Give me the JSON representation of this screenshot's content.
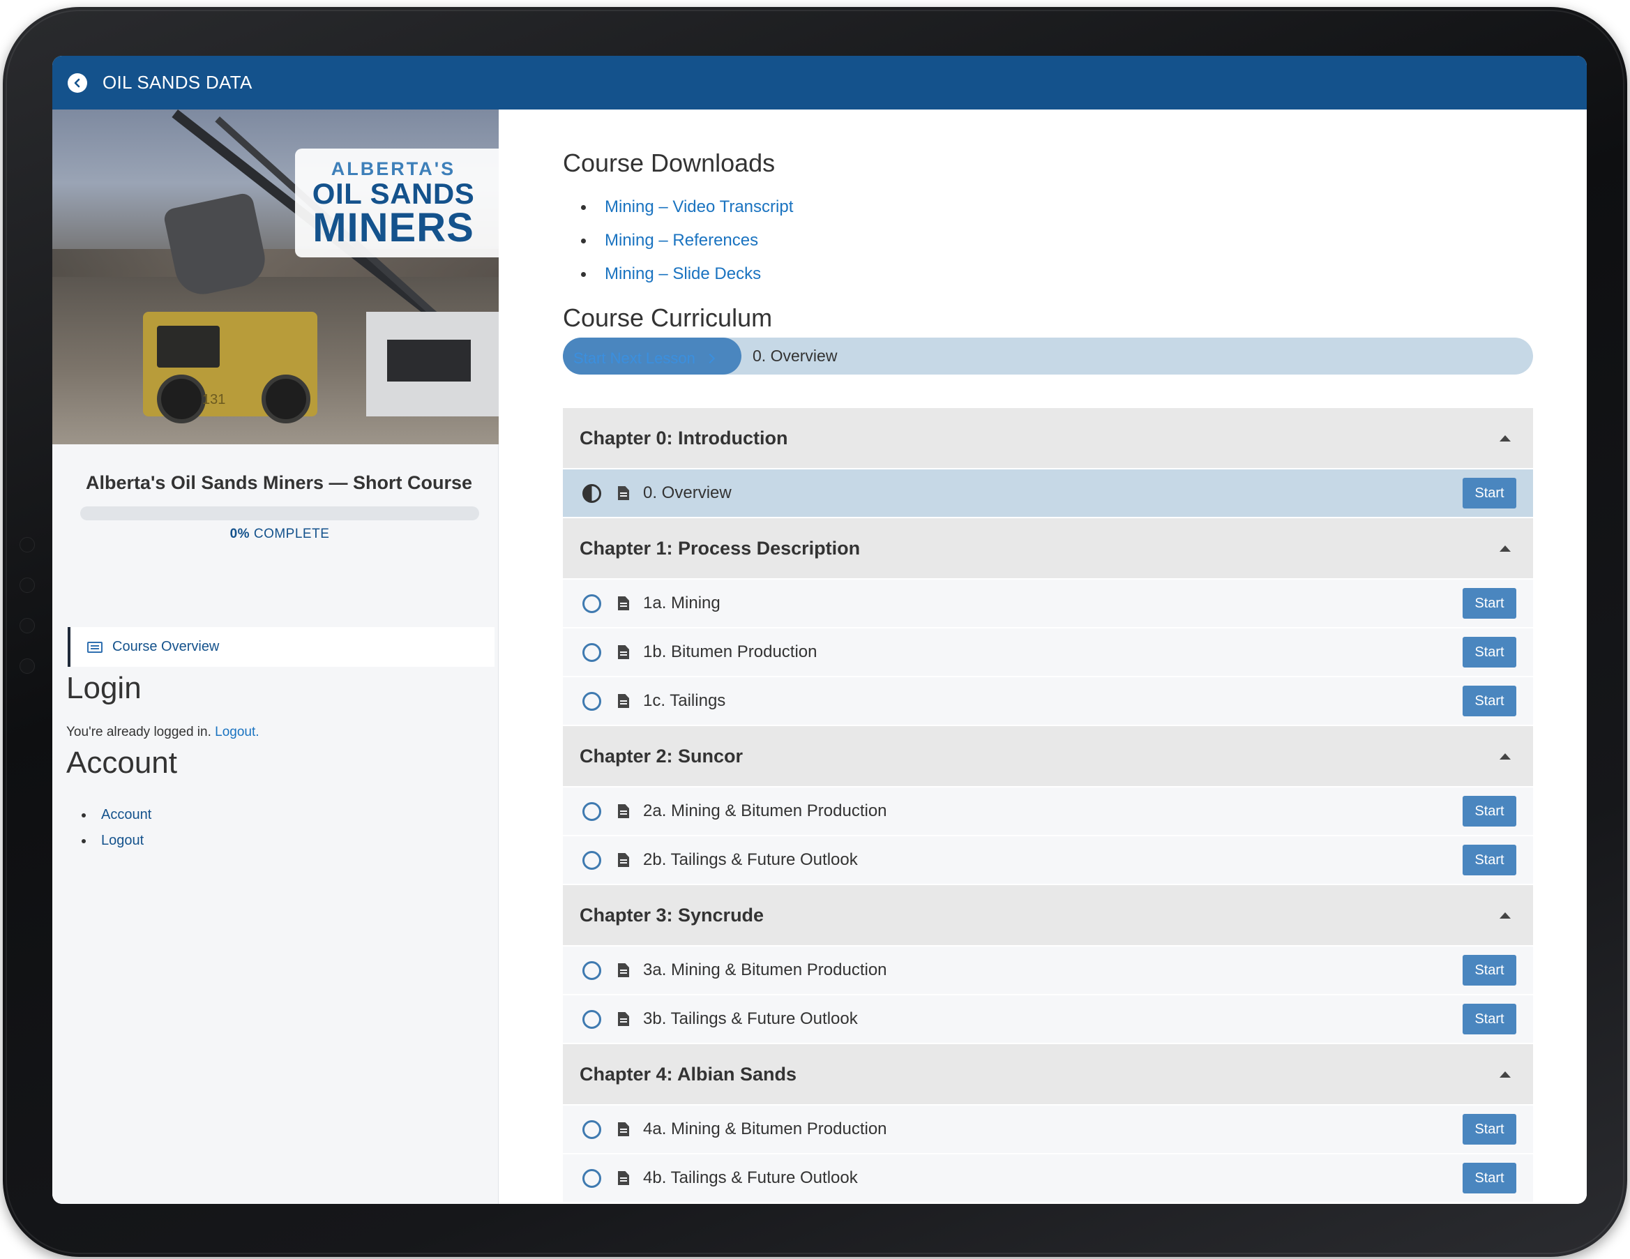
{
  "header": {
    "site_title": "OIL SANDS DATA"
  },
  "hero": {
    "logo_line1": "ALBERTA'S",
    "logo_line2": "OIL SANDS",
    "logo_line3": "MINERS",
    "truck_number": "131"
  },
  "sidebar": {
    "course_title": "Alberta's Oil Sands Miners — Short Course",
    "progress_percent": 0,
    "progress_value": "0%",
    "progress_label": " COMPLETE",
    "overview_link": "Course Overview",
    "login_heading": "Login",
    "login_text": "You're already logged in.",
    "logout_link": "Logout.",
    "account_heading": "Account",
    "account_links": [
      "Account",
      "Logout"
    ]
  },
  "main": {
    "downloads_heading": "Course Downloads",
    "downloads": [
      "Mining – Video Transcript",
      "Mining – References",
      "Mining – Slide Decks"
    ],
    "curriculum_heading": "Course Curriculum",
    "next_button": "Start Next Lesson",
    "next_lesson": "0. Overview",
    "start_label": "Start",
    "chapters": [
      {
        "title": "Chapter 0: Introduction",
        "lessons": [
          "0. Overview"
        ]
      },
      {
        "title": "Chapter 1: Process Description",
        "lessons": [
          "1a. Mining",
          "1b. Bitumen Production",
          "1c. Tailings"
        ]
      },
      {
        "title": "Chapter 2: Suncor",
        "lessons": [
          "2a. Mining & Bitumen Production",
          "2b. Tailings & Future Outlook"
        ]
      },
      {
        "title": "Chapter 3: Syncrude",
        "lessons": [
          "3a. Mining & Bitumen Production",
          "3b. Tailings & Future Outlook"
        ]
      },
      {
        "title": "Chapter 4: Albian Sands",
        "lessons": [
          "4a. Mining & Bitumen Production",
          "4b. Tailings & Future Outlook"
        ]
      }
    ]
  }
}
